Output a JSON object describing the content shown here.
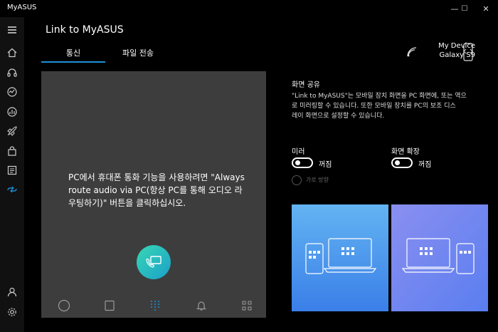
{
  "window": {
    "title": "MyASUS",
    "minimize_glyph": "—",
    "maximize_glyph": "☐",
    "close_glyph": "✕"
  },
  "sidebar": {
    "items": [
      {
        "icon": "hamburger-menu-icon"
      },
      {
        "icon": "home-icon"
      },
      {
        "icon": "headset-icon"
      },
      {
        "icon": "diagnostics-icon"
      },
      {
        "icon": "performance-gauge-icon"
      },
      {
        "icon": "rocket-icon"
      },
      {
        "icon": "store-bag-icon"
      },
      {
        "icon": "news-icon"
      },
      {
        "icon": "link-icon",
        "active": true
      },
      {
        "icon": "user-icon"
      },
      {
        "icon": "settings-icon"
      }
    ],
    "accent": "#1e90d6"
  },
  "header": {
    "title": "Link to MyASUS",
    "tabs": [
      {
        "label": "통신",
        "active": true
      },
      {
        "label": "파일 전송",
        "active": false
      }
    ],
    "device": {
      "label": "My Device",
      "name": "Galaxy S9"
    }
  },
  "mirror": {
    "message": "PC에서 휴대폰 통화 기능을 사용하려면 \"Always route audio via PC(항상 PC를 통해 오디오 라우팅하기)\" 버튼을 클릭하십시오.",
    "bottom_nav": [
      "circle-icon",
      "square-icon",
      "dialpad-icon",
      "bell-icon",
      "apps-grid-icon"
    ],
    "call_button_colors": [
      "#38d7b5",
      "#1aa0c8"
    ]
  },
  "screen_share": {
    "title": "화면 공유",
    "description": "\"Link to MyASUS\"는 모바일 장치 화면을 PC 화면에, 또는 역으\n로 미러링할 수 있습니다. 또한 모바일 장치를 PC의 보조 디스\n레이 화면으로 설정할 수 있습니다.",
    "mirror_label": "미러",
    "mirror_state": "꺼짐",
    "extend_label": "화면 확장",
    "extend_state": "꺼짐",
    "orientation_label": "가로 방향"
  }
}
